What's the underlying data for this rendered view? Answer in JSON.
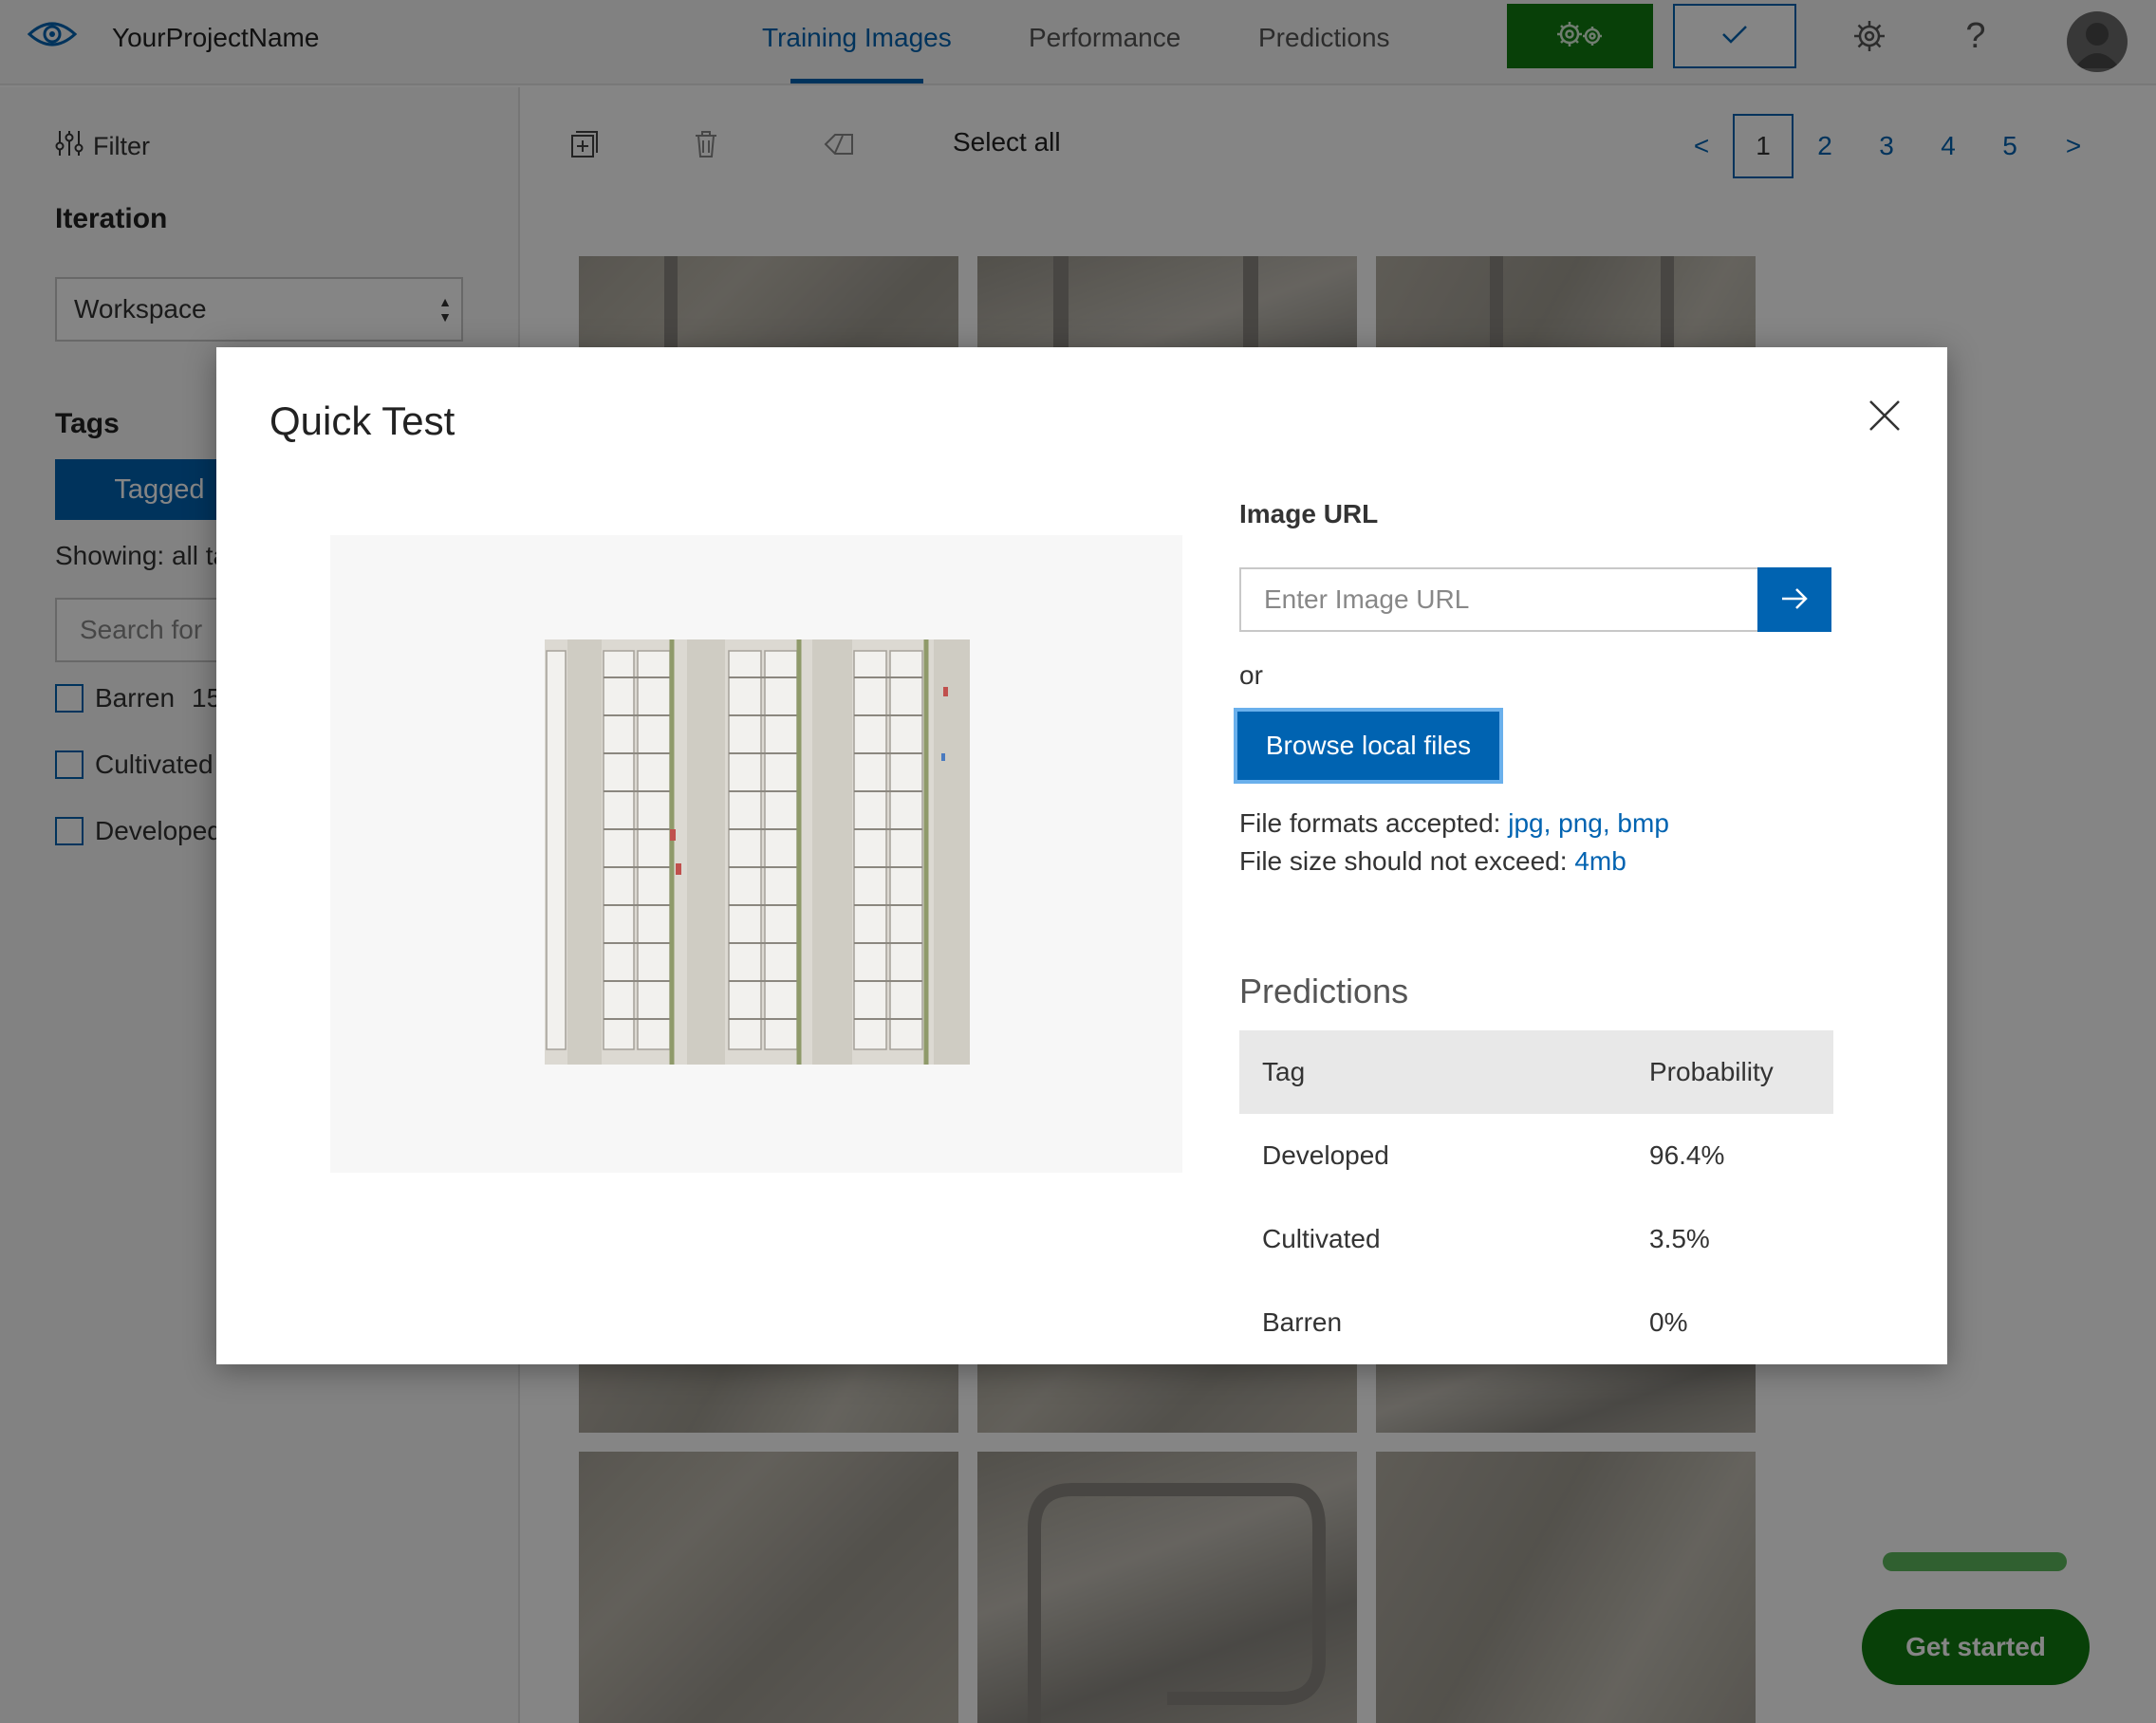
{
  "header": {
    "project_name": "YourProjectName",
    "tabs": [
      {
        "label": "Training Images",
        "active": true
      },
      {
        "label": "Performance",
        "active": false
      },
      {
        "label": "Predictions",
        "active": false
      }
    ],
    "accent_color": "#0063b1",
    "train_color": "#107c10",
    "icons": [
      "eye-icon",
      "gears-icon",
      "checkmark-icon",
      "settings-icon",
      "help-icon",
      "avatar-icon"
    ]
  },
  "left_panel": {
    "filter_label": "Filter",
    "iteration_label": "Iteration",
    "iteration_value": "Workspace",
    "tags_label": "Tags",
    "tagged_button": "Tagged",
    "showing_text": "Showing: all ta",
    "search_placeholder": "Search for",
    "tags": [
      {
        "name": "Barren",
        "count": "15"
      },
      {
        "name": "Cultivated",
        "count": ""
      },
      {
        "name": "Developed",
        "count": ""
      }
    ]
  },
  "toolbar": {
    "select_all": "Select all",
    "pager": {
      "prev": "<",
      "pages": [
        "1",
        "2",
        "3",
        "4",
        "5"
      ],
      "current": "1",
      "next": ">"
    }
  },
  "get_started": "Get started",
  "modal": {
    "title": "Quick Test",
    "image_url_label": "Image URL",
    "image_url_placeholder": "Enter Image URL",
    "image_url_value": "",
    "or_text": "or",
    "browse_button": "Browse local files",
    "formats_label": "File formats accepted:",
    "formats_value": "jpg, png, bmp",
    "size_label": "File size should not exceed:",
    "size_value": "4mb",
    "predictions_title": "Predictions",
    "table": {
      "headers": [
        "Tag",
        "Probability"
      ],
      "rows": [
        {
          "tag": "Developed",
          "probability": "96.4%"
        },
        {
          "tag": "Cultivated",
          "probability": "3.5%"
        },
        {
          "tag": "Barren",
          "probability": "0%"
        }
      ]
    }
  }
}
